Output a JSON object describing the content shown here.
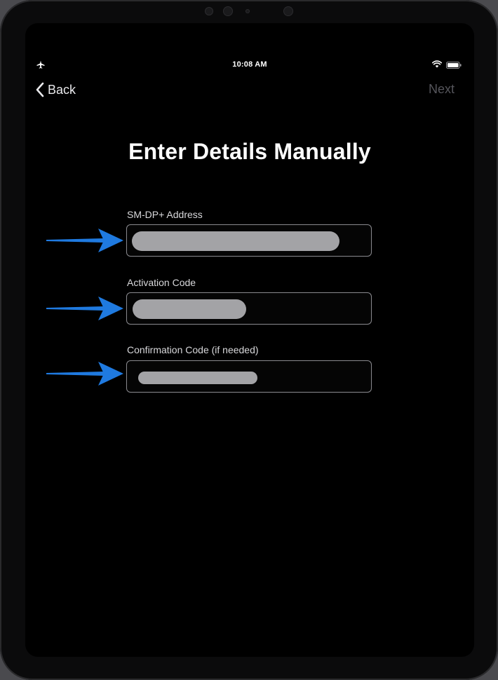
{
  "status_bar": {
    "time": "10:08 AM",
    "icons": [
      "airplane-icon",
      "wifi-icon",
      "battery-icon"
    ]
  },
  "nav": {
    "back_label": "Back",
    "next_label": "Next"
  },
  "page": {
    "title": "Enter Details Manually"
  },
  "fields": [
    {
      "label": "SM-DP+ Address",
      "value": ""
    },
    {
      "label": "Activation Code",
      "value": ""
    },
    {
      "label": "Confirmation Code (if needed)",
      "value": ""
    }
  ],
  "colors": {
    "background": "#000000",
    "text": "#ffffff",
    "disabled_text": "#55555b",
    "field_border": "#8a8a8f",
    "redaction": "#a3a3a6",
    "arrow": "#1f7ae0"
  },
  "annotations": {
    "arrow_icon": "arrow-right-icon"
  }
}
